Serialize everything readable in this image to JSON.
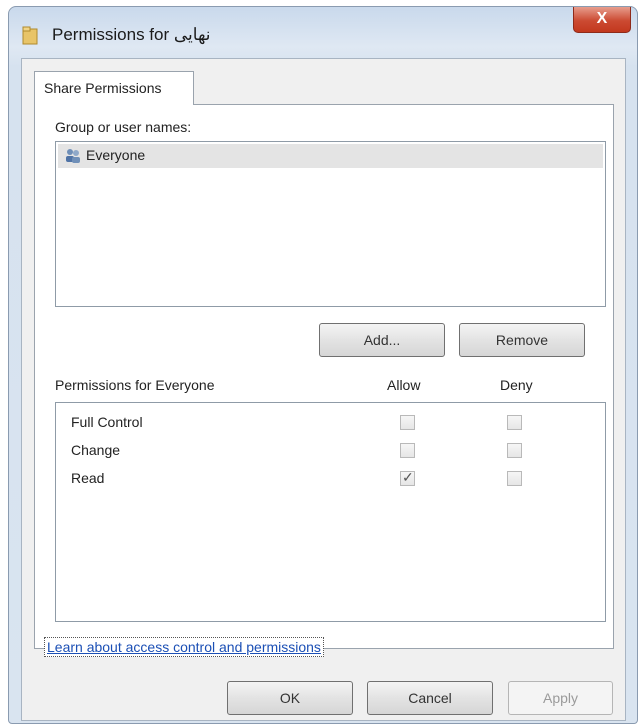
{
  "window": {
    "title": "Permissions for نهایی",
    "close_label": "X"
  },
  "tabs": [
    {
      "label": "Share Permissions",
      "active": true
    }
  ],
  "group_section": {
    "label": "Group or user names:",
    "users": [
      {
        "name": "Everyone",
        "icon": "users-group-icon",
        "selected": true
      }
    ],
    "add_label": "Add...",
    "remove_label": "Remove"
  },
  "permissions_section": {
    "label": "Permissions for Everyone",
    "allow_header": "Allow",
    "deny_header": "Deny",
    "rows": [
      {
        "name": "Full Control",
        "allow": false,
        "deny": false
      },
      {
        "name": "Change",
        "allow": false,
        "deny": false
      },
      {
        "name": "Read",
        "allow": true,
        "deny": false
      }
    ]
  },
  "link": {
    "text": "Learn about access control and permissions"
  },
  "footer": {
    "ok_label": "OK",
    "cancel_label": "Cancel",
    "apply_label": "Apply",
    "apply_enabled": false
  }
}
